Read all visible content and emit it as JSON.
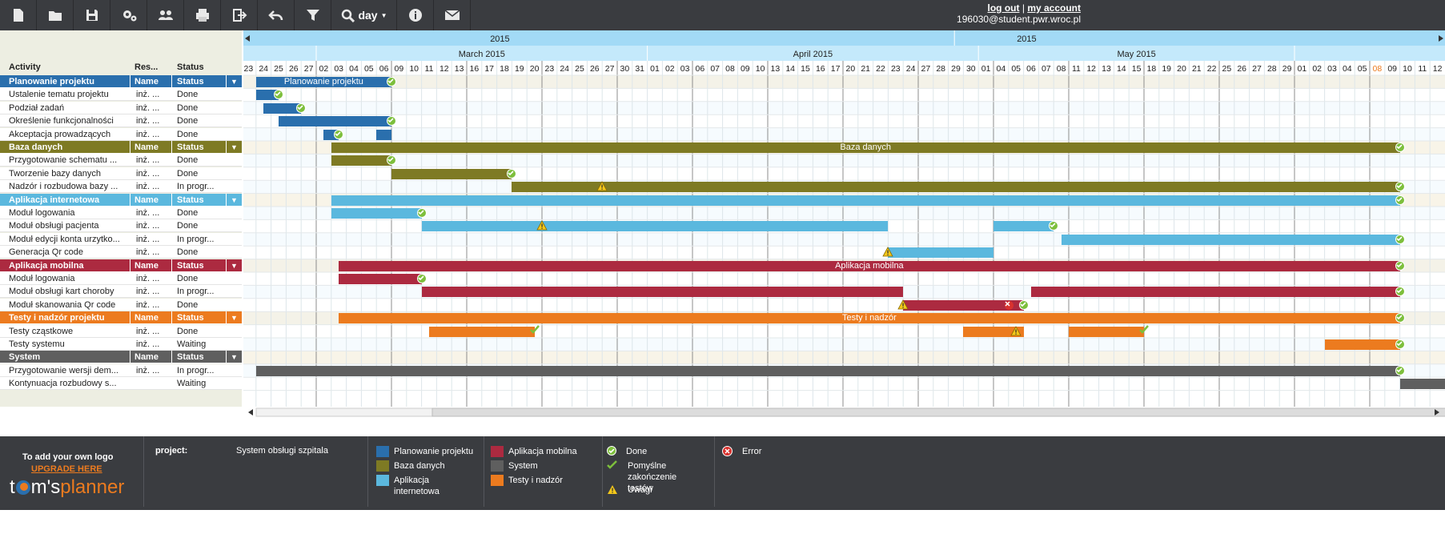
{
  "toolbar": {
    "buttons": [
      "new-file-icon",
      "open-folder-icon",
      "save-icon",
      "settings-icon",
      "users-icon",
      "print-icon",
      "export-icon",
      "undo-icon",
      "filter-icon"
    ],
    "zoom_label": "day",
    "info_icon": "info-icon",
    "mail_icon": "mail-icon"
  },
  "account": {
    "logout": "log out",
    "sep": "|",
    "my_account": "my account",
    "email": "196030@student.pwr.wroc.pl"
  },
  "left_headers": {
    "activity": "Activity",
    "resource": "Res...",
    "status": "Status"
  },
  "groups": [
    {
      "name": "Planowanie projektu",
      "col2": "Name",
      "col3": "Status",
      "color": "#2a6fad",
      "tasks": [
        {
          "name": "Ustalenie tematu projektu",
          "res": "inż. ...",
          "status": "Done"
        },
        {
          "name": "Podział zadań",
          "res": "inż. ...",
          "status": "Done"
        },
        {
          "name": "Określenie funkcjonalności",
          "res": "inż. ...",
          "status": "Done"
        },
        {
          "name": "Akceptacja prowadzących",
          "res": "inż. ...",
          "status": "Done"
        }
      ]
    },
    {
      "name": "Baza danych",
      "col2": "Name",
      "col3": "Status",
      "color": "#7e7a24",
      "tasks": [
        {
          "name": "Przygotowanie schematu ...",
          "res": "inż. ...",
          "status": "Done"
        },
        {
          "name": "Tworzenie bazy danych",
          "res": "inż. ...",
          "status": "Done"
        },
        {
          "name": "Nadzór i rozbudowa bazy ...",
          "res": "inż. ...",
          "status": "In progr..."
        }
      ]
    },
    {
      "name": "Aplikacja internetowa",
      "col2": "Name",
      "col3": "Status",
      "color": "#5bb8de",
      "tasks": [
        {
          "name": "Moduł logowania",
          "res": "inż. ...",
          "status": "Done"
        },
        {
          "name": "Moduł obsługi pacjenta",
          "res": "inż. ...",
          "status": "Done"
        },
        {
          "name": "Moduł edycji konta urzytko...",
          "res": "inż. ...",
          "status": "In progr..."
        },
        {
          "name": "Generacja Qr code",
          "res": "inż. ...",
          "status": "Done"
        }
      ]
    },
    {
      "name": "Aplikacja mobilna",
      "col2": "Name",
      "col3": "Status",
      "color": "#ac2a40",
      "tasks": [
        {
          "name": "Moduł logowania",
          "res": "inż. ...",
          "status": "Done"
        },
        {
          "name": "Moduł obsługi kart choroby",
          "res": "inż. ...",
          "status": "In progr..."
        },
        {
          "name": "Moduł skanowania Qr code",
          "res": "inż. ...",
          "status": "Done"
        }
      ]
    },
    {
      "name": "Testy i nadzór projektu",
      "col2": "Name",
      "col3": "Status",
      "color": "#ec7b1f",
      "tasks": [
        {
          "name": "Testy cząstkowe",
          "res": "inż. ...",
          "status": "Done"
        },
        {
          "name": "Testy systemu",
          "res": "inż. ...",
          "status": "Waiting"
        }
      ]
    },
    {
      "name": "System",
      "col2": "Name",
      "col3": "Status",
      "color": "#5f5f5f",
      "tasks": [
        {
          "name": "Przygotowanie wersji dem...",
          "res": "inż. ...",
          "status": "In progr..."
        },
        {
          "name": "Kontynuacja rozbudowy s...",
          "res": "",
          "status": "Waiting"
        }
      ]
    }
  ],
  "timeline": {
    "years": [
      "2015",
      "2015"
    ],
    "months": [
      "March 2015",
      "April 2015",
      "May 2015"
    ],
    "days": [
      "23",
      "24",
      "25",
      "26",
      "27",
      "02",
      "03",
      "04",
      "05",
      "06",
      "09",
      "10",
      "11",
      "12",
      "13",
      "16",
      "17",
      "18",
      "19",
      "20",
      "23",
      "24",
      "25",
      "26",
      "27",
      "30",
      "31",
      "01",
      "02",
      "03",
      "06",
      "07",
      "08",
      "09",
      "10",
      "13",
      "14",
      "15",
      "16",
      "17",
      "20",
      "21",
      "22",
      "23",
      "24",
      "27",
      "28",
      "29",
      "30",
      "01",
      "04",
      "05",
      "06",
      "07",
      "08",
      "11",
      "12",
      "13",
      "14",
      "15",
      "18",
      "19",
      "20",
      "21",
      "22",
      "25",
      "26",
      "27",
      "28",
      "29",
      "01",
      "02",
      "03",
      "04",
      "05",
      "08",
      "09",
      "10",
      "11",
      "12"
    ],
    "highlight_day_index": 75,
    "week_starts": [
      5,
      10,
      15,
      20,
      25,
      30,
      35,
      40,
      45,
      50,
      55,
      60,
      65,
      70,
      75
    ],
    "month_starts": [
      5,
      27,
      49,
      70
    ]
  },
  "bars": [
    {
      "row": 0,
      "start": 1,
      "end": 10,
      "color": "#2a6fad",
      "label": "Planowanie projektu",
      "marker": "done"
    },
    {
      "row": 1,
      "start": 1,
      "end": 2.5,
      "color": "#2a6fad",
      "marker": "done"
    },
    {
      "row": 2,
      "start": 1.5,
      "end": 4,
      "color": "#2a6fad",
      "marker": "done"
    },
    {
      "row": 3,
      "start": 2.5,
      "end": 10,
      "color": "#2a6fad",
      "marker": "done"
    },
    {
      "row": 4,
      "start": 5.5,
      "end": 6.5,
      "color": "#2a6fad",
      "marker": "done"
    },
    {
      "row": 4,
      "start": 9,
      "end": 10,
      "color": "#2a6fad"
    },
    {
      "row": 5,
      "start": 6,
      "end": 77,
      "color": "#7e7a24",
      "label": "Baza danych",
      "marker": "done"
    },
    {
      "row": 6,
      "start": 6,
      "end": 10,
      "color": "#7e7a24",
      "marker": "done"
    },
    {
      "row": 7,
      "start": 10,
      "end": 18,
      "color": "#7e7a24",
      "marker": "done"
    },
    {
      "row": 8,
      "start": 18,
      "end": 77,
      "color": "#7e7a24",
      "marker": "done",
      "warn": 24
    },
    {
      "row": 9,
      "start": 6,
      "end": 77,
      "color": "#5bb8de",
      "marker": "done"
    },
    {
      "row": 10,
      "start": 6,
      "end": 12,
      "color": "#5bb8de",
      "marker": "done"
    },
    {
      "row": 11,
      "start": 12,
      "end": 43,
      "color": "#5bb8de",
      "warn": 20
    },
    {
      "row": 11,
      "start": 50,
      "end": 54,
      "color": "#5bb8de",
      "marker": "done"
    },
    {
      "row": 12,
      "start": 54.5,
      "end": 77,
      "color": "#5bb8de",
      "marker": "done"
    },
    {
      "row": 13,
      "start": 43,
      "end": 50,
      "color": "#5bb8de",
      "warn": 43
    },
    {
      "row": 14,
      "start": 6.5,
      "end": 77,
      "color": "#ac2a40",
      "label": "Aplikacja mobilna",
      "marker": "done"
    },
    {
      "row": 15,
      "start": 6.5,
      "end": 12,
      "color": "#ac2a40",
      "marker": "done"
    },
    {
      "row": 16,
      "start": 12,
      "end": 44,
      "color": "#ac2a40"
    },
    {
      "row": 16,
      "start": 52.5,
      "end": 77,
      "color": "#ac2a40",
      "marker": "done"
    },
    {
      "row": 17,
      "start": 44,
      "end": 52,
      "color": "#ac2a40",
      "warn": 44,
      "err": 51,
      "marker": "done"
    },
    {
      "row": 18,
      "start": 6.5,
      "end": 77,
      "color": "#ec7b1f",
      "label": "Testy i nadzór",
      "marker": "done"
    },
    {
      "row": 19,
      "start": 12.5,
      "end": 19.5,
      "color": "#ec7b1f",
      "marker": "check"
    },
    {
      "row": 19,
      "start": 48,
      "end": 52,
      "color": "#ec7b1f",
      "warn": 51.5
    },
    {
      "row": 19,
      "start": 55,
      "end": 60,
      "color": "#ec7b1f",
      "marker": "check"
    },
    {
      "row": 20,
      "start": 72,
      "end": 77,
      "color": "#ec7b1f",
      "marker": "done"
    },
    {
      "row": 22,
      "start": 1,
      "end": 77,
      "color": "#5f5f5f",
      "marker": "done"
    },
    {
      "row": 23,
      "start": 77,
      "end": 80,
      "color": "#5f5f5f"
    }
  ],
  "footer": {
    "logo_text": "To add your own logo",
    "upgrade": "UPGRADE HERE",
    "brand": "t",
    "brand2": "m's",
    "brand3": "planner",
    "project_label": "project:",
    "project_name": "System obsługi szpitala",
    "legend_colors": [
      {
        "label": "Planowanie projektu",
        "color": "#2a6fad"
      },
      {
        "label": "Baza danych",
        "color": "#7e7a24"
      },
      {
        "label": "Aplikacja internetowa",
        "color": "#5bb8de"
      },
      {
        "label": "Aplikacja mobilna",
        "color": "#ac2a40"
      },
      {
        "label": "System",
        "color": "#5f5f5f"
      },
      {
        "label": "Testy i nadzór",
        "color": "#ec7b1f"
      }
    ],
    "legend_icons": [
      {
        "label": "Done",
        "icon": "done-icon"
      },
      {
        "label": "Pomyślne zakończenie testów",
        "icon": "check-icon"
      },
      {
        "label": "Uwagi",
        "icon": "warning-icon"
      },
      {
        "label": "Error",
        "icon": "error-icon"
      }
    ]
  }
}
